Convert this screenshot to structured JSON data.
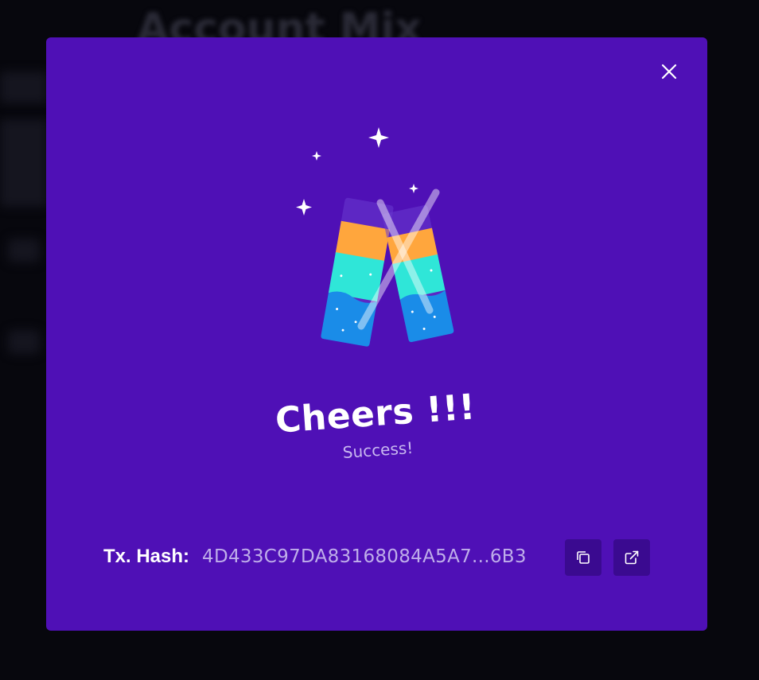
{
  "background": {
    "title": "Account Mix"
  },
  "modal": {
    "heading": "Cheers !!!",
    "subheading": "Success!",
    "tx_hash_label": "Tx. Hash:",
    "tx_hash_value": "4D433C97DA83168084A5A7...6B3",
    "close_icon": "close-icon",
    "copy_icon": "copy-icon",
    "external_link_icon": "external-link-icon",
    "illustration": "cheers-glasses-illustration"
  },
  "colors": {
    "modal_background": "#4f10b6",
    "icon_button_background": "#3a0a90",
    "orange": "#ffa63d",
    "teal": "#2fe6d8",
    "blue": "#1a8ce8"
  }
}
